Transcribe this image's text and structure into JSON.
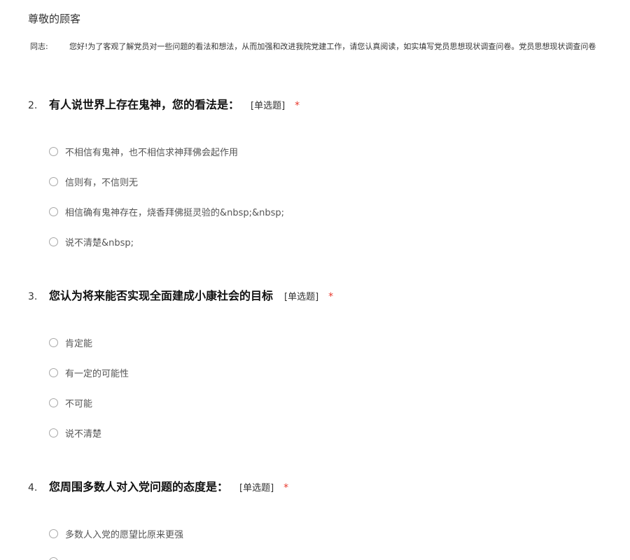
{
  "greeting": "尊敬的顾客",
  "intro": {
    "label": "同志:",
    "text": "您好!为了客观了解党员对一些问题的看法和想法，从而加强和改进我院党建工作，请您认真阅读，如实填写党员思想现状调查问卷。党员思想现状调查问卷"
  },
  "questions": [
    {
      "number": "2.",
      "title": "有人说世界上存在鬼神，您的看法是：",
      "type": "[单选题]",
      "required": "*",
      "options": [
        "不相信有鬼神，也不相信求神拜佛会起作用",
        "信则有，不信则无",
        "相信确有鬼神存在，烧香拜佛挺灵验的&nbsp;&nbsp;",
        "说不清楚&nbsp;"
      ]
    },
    {
      "number": "3.",
      "title": "您认为将来能否实现全面建成小康社会的目标",
      "type": "[单选题]",
      "required": "*",
      "options": [
        "肯定能",
        "有一定的可能性",
        "不可能",
        "说不清楚"
      ]
    },
    {
      "number": "4.",
      "title": "您周围多数人对入党问题的态度是：",
      "type": "[单选题]",
      "required": "*",
      "options": [
        "多数人入党的愿望比原来更强",
        ""
      ]
    }
  ]
}
